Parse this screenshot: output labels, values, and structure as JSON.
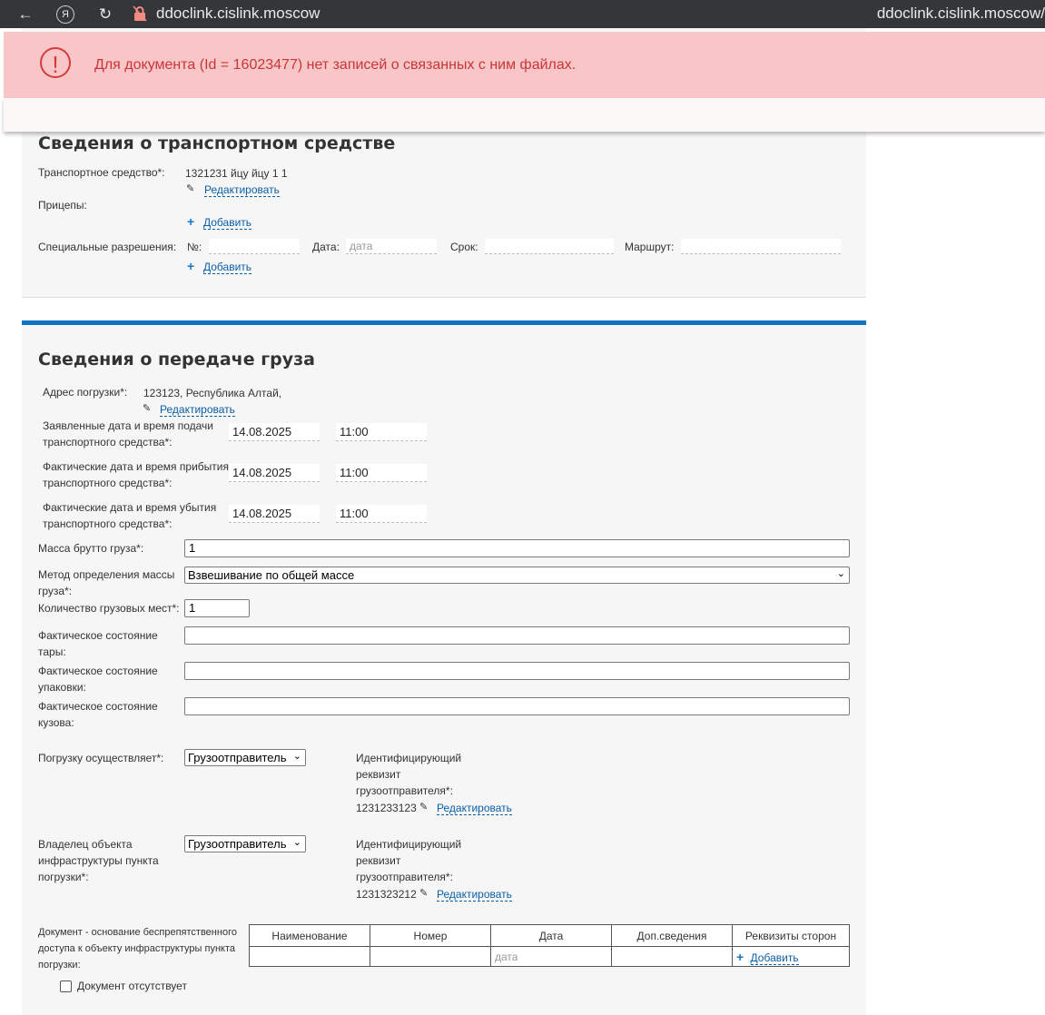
{
  "browser": {
    "back_icon": "←",
    "yandex_icon": "Я",
    "reload_icon": "↻",
    "url": "ddoclink.cislink.moscow",
    "url_right": "ddoclink.cislink.moscow/"
  },
  "alert": {
    "message": "Для документа (Id = 16023477) нет записей о связанных с ним файлах.",
    "icon": "!",
    "color": "#d63b3b"
  },
  "vehicle": {
    "title": "Сведения о транспортном средстве",
    "vehicle_label": "Транспортное средство*:",
    "vehicle_value": "1321231 йцу йцу 1 1",
    "edit_label": "Редактировать",
    "trailers_label": "Прицепы:",
    "add_label": "Добавить",
    "permits_label": "Специальные разрешения:",
    "permit_no_label": "№:",
    "permit_date_label": "Дата:",
    "permit_date_placeholder": "дата",
    "permit_term_label": "Срок:",
    "permit_route_label": "Маршрут:",
    "add_label2": "Добавить"
  },
  "cargo": {
    "title": "Сведения о передаче груза",
    "address_label": "Адрес погрузки*:",
    "address_value": "123123, Республика Алтай,",
    "edit_label": "Редактировать",
    "declared_label": "Заявленные дата и время подачи транспортного средства*:",
    "declared_date": "14.08.2025",
    "declared_time": "11:00",
    "arrival_label": "Фактические дата и время прибытия транспортного средства*:",
    "arrival_date": "14.08.2025",
    "arrival_time": "11:00",
    "departure_label": "Фактические дата и время убытия транспортного средства*:",
    "departure_date": "14.08.2025",
    "departure_time": "11:00",
    "gross_label": "Масса брутто груза*:",
    "gross_value": "1",
    "method_label": "Метод определения массы груза*:",
    "method_value": "Взвешивание по общей массе",
    "places_label": "Количество грузовых мест*:",
    "places_value": "1",
    "tare_label": "Фактическое состояние тары:",
    "package_label": "Фактическое состояние упаковки:",
    "body_label": "Фактическое состояние кузова:",
    "loader_label": "Погрузку осуществляет*:",
    "loader_value": "Грузоотправитель",
    "loader_req_label": "Идентифицирующий реквизит грузоотправителя*:",
    "loader_req_value": "1231233123",
    "owner_label": "Владелец объекта инфраструктуры пункта погрузки*:",
    "owner_value": "Грузоотправитель",
    "owner_req_label": "Идентифицирующий реквизит грузоотправителя*:",
    "owner_req_value": "1231323212",
    "doc_label": "Документ - основание беспрепятственного доступа к объекту инфраструктуры пункта погрузки:",
    "doc_columns": [
      "Наименование",
      "Номер",
      "Дата",
      "Доп.сведения",
      "Реквизиты сторон"
    ],
    "doc_date_placeholder": "дата",
    "doc_add_label": "Добавить",
    "doc_absent_label": "Документ отсутствует"
  }
}
